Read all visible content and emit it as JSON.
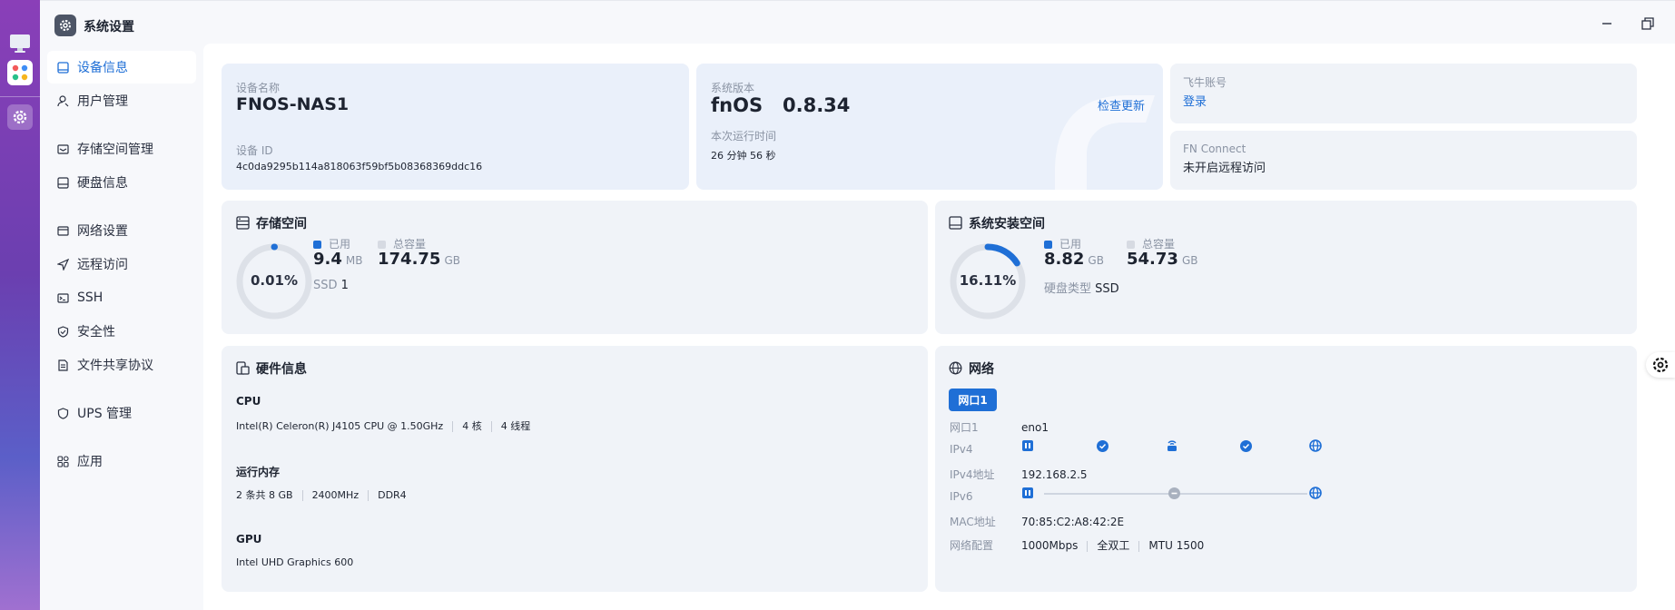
{
  "window": {
    "title": "系统设置"
  },
  "sidebar": {
    "items": [
      {
        "label": "设备信息"
      },
      {
        "label": "用户管理"
      },
      {
        "label": "存储空间管理"
      },
      {
        "label": "硬盘信息"
      },
      {
        "label": "网络设置"
      },
      {
        "label": "远程访问"
      },
      {
        "label": "SSH"
      },
      {
        "label": "安全性"
      },
      {
        "label": "文件共享协议"
      },
      {
        "label": "UPS 管理"
      },
      {
        "label": "应用"
      }
    ]
  },
  "device": {
    "name_label": "设备名称",
    "name": "FNOS-NAS1",
    "id_label": "设备 ID",
    "id": "4c0da9295b114a818063f59bf5b08368369ddc16"
  },
  "version": {
    "label": "系统版本",
    "value": "fnOS   0.8.34",
    "check_update": "检查更新",
    "uptime_label": "本次运行时间",
    "uptime": "26 分钟 56 秒"
  },
  "account": {
    "label": "飞牛账号",
    "login": "登录"
  },
  "fn_connect": {
    "label": "FN Connect",
    "status": "未开启远程访问"
  },
  "storage": {
    "title": "存储空间",
    "percent_text": "0.01%",
    "percent": 0.0001,
    "used_label": "已用",
    "used_value": "9.4",
    "used_unit": "MB",
    "total_label": "总容量",
    "total_value": "174.75",
    "total_unit": "GB",
    "ssd_label": "SSD",
    "ssd_count": "1"
  },
  "system_space": {
    "title": "系统安装空间",
    "percent_text": "16.11%",
    "percent": 0.1611,
    "used_label": "已用",
    "used_value": "8.82",
    "used_unit": "GB",
    "total_label": "总容量",
    "total_value": "54.73",
    "total_unit": "GB",
    "disk_type_label": "硬盘类型",
    "disk_type": "SSD"
  },
  "hardware": {
    "title": "硬件信息",
    "cpu_label": "CPU",
    "cpu_model": "Intel(R) Celeron(R) J4105 CPU @ 1.50GHz",
    "cpu_cores": "4 核",
    "cpu_threads": "4 线程",
    "mem_label": "运行内存",
    "mem_size": "2 条共 8 GB",
    "mem_freq": "2400MHz",
    "mem_type": "DDR4",
    "gpu_label": "GPU",
    "gpu_model": "Intel UHD Graphics 600"
  },
  "network": {
    "title": "网络",
    "port_tab": "网口1",
    "port_label": "网口1",
    "port_value": "eno1",
    "ipv4_label": "IPv4",
    "ipv4_addr_label": "IPv4地址",
    "ipv4_addr": "192.168.2.5",
    "ipv6_label": "IPv6",
    "mac_label": "MAC地址",
    "mac": "70:85:C2:A8:42:2E",
    "config_label": "网络配置",
    "speed": "1000Mbps",
    "duplex": "全双工",
    "mtu": "MTU 1500"
  },
  "colors": {
    "accent": "#1f6fd6",
    "card_bg": "#f0f3f8",
    "ring_track": "#dde1e8"
  }
}
